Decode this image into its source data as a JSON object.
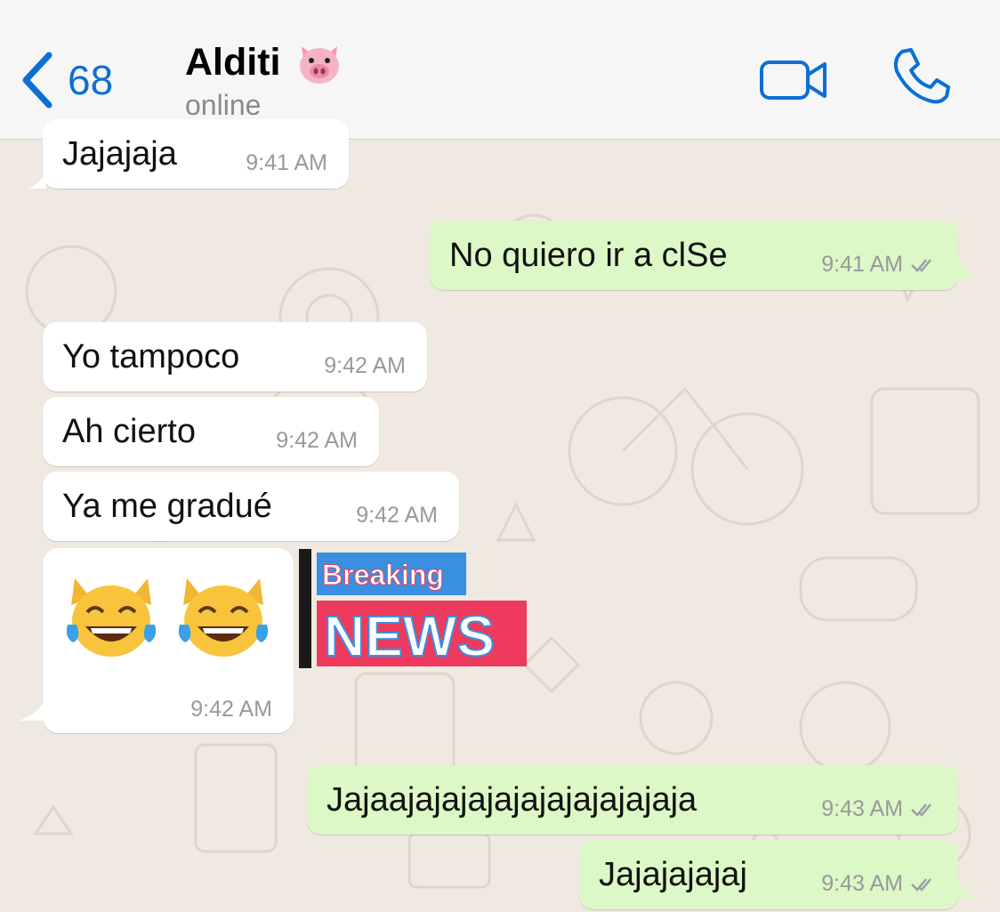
{
  "header": {
    "back_count": "68",
    "contact_name": "Alditi",
    "contact_emoji_icon": "pig-face-icon",
    "status": "online",
    "accent_color": "#0b6fd6"
  },
  "messages": [
    {
      "direction": "in",
      "text": "Jajajaja",
      "time": "9:41 AM"
    },
    {
      "direction": "out",
      "text": "No quiero ir a clSe",
      "time": "9:41 AM",
      "read": true
    },
    {
      "direction": "in",
      "text": "Yo tampoco",
      "time": "9:42 AM"
    },
    {
      "direction": "in",
      "text": "Ah cierto",
      "time": "9:42 AM"
    },
    {
      "direction": "in",
      "text": "Ya me gradué",
      "time": "9:42 AM"
    },
    {
      "direction": "in",
      "emoji": [
        "cat-tears-of-joy-icon",
        "cat-tears-of-joy-icon"
      ],
      "time": "9:42 AM"
    },
    {
      "direction": "in",
      "sticker": {
        "line1": "Breaking",
        "line2": "NEWS"
      }
    },
    {
      "direction": "out",
      "text": "Jajaajajajajajajajajajajaja",
      "time": "9:43 AM",
      "read": true
    },
    {
      "direction": "out",
      "text": "Jajajajajaj",
      "time": "9:43 AM",
      "read": true
    }
  ],
  "colors": {
    "incoming_bubble": "#ffffff",
    "outgoing_bubble": "#dcf8c6",
    "chat_background": "#efe9e1",
    "read_ticks": "#9aa0a6"
  }
}
